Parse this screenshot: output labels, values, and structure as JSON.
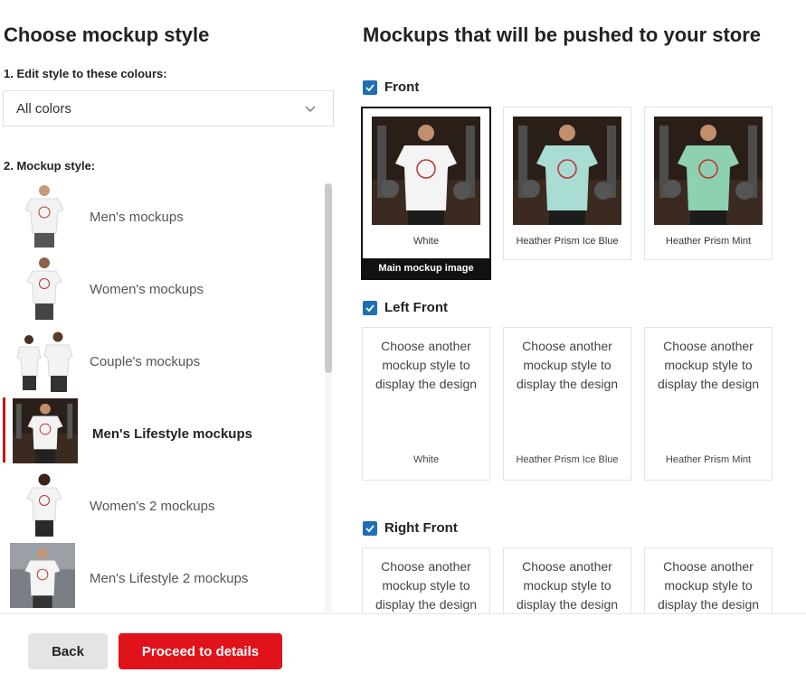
{
  "left": {
    "title": "Choose mockup style",
    "colour_label": "1. Edit style to these colours:",
    "colour_select": "All colors",
    "style_label": "2. Mockup style:",
    "styles": [
      {
        "name": "Men's mockups",
        "active": false
      },
      {
        "name": "Women's mockups",
        "active": false
      },
      {
        "name": "Couple's mockups",
        "active": false
      },
      {
        "name": "Men's Lifestyle mockups",
        "active": true
      },
      {
        "name": "Women's 2 mockups",
        "active": false
      },
      {
        "name": "Men's Lifestyle 2 mockups",
        "active": false
      }
    ]
  },
  "right": {
    "title": "Mockups that will be pushed to your store",
    "sections": [
      {
        "name": "Front",
        "checked": true,
        "cards": [
          {
            "color": "White",
            "tag": "Main mockup image"
          },
          {
            "color": "Heather Prism Ice Blue"
          },
          {
            "color": "Heather Prism Mint"
          }
        ]
      },
      {
        "name": "Left Front",
        "checked": true,
        "cards": [
          {
            "color": "White",
            "message": "Choose another mockup style to display the design"
          },
          {
            "color": "Heather Prism Ice Blue",
            "message": "Choose another mockup style to display the design"
          },
          {
            "color": "Heather Prism Mint",
            "message": "Choose another mockup style to display the design"
          }
        ]
      },
      {
        "name": "Right Front",
        "checked": true,
        "cards": [
          {
            "message": "Choose another mockup style to display the design"
          },
          {
            "message": "Choose another mockup style to display the design"
          },
          {
            "message": "Choose another mockup style to display the design"
          }
        ]
      }
    ]
  },
  "footer": {
    "back_label": "Back",
    "proceed_label": "Proceed to details"
  },
  "colors": {
    "accent_red": "#e0121b",
    "active_bar": "#c7131c",
    "checkbox_blue": "#1f6fb5",
    "shirt_white": "#f4f4f4",
    "shirt_ice_blue": "#a9dcd3",
    "shirt_mint": "#8ed1b0"
  },
  "icons": [
    "chevron-down-icon",
    "checkmark-icon"
  ]
}
